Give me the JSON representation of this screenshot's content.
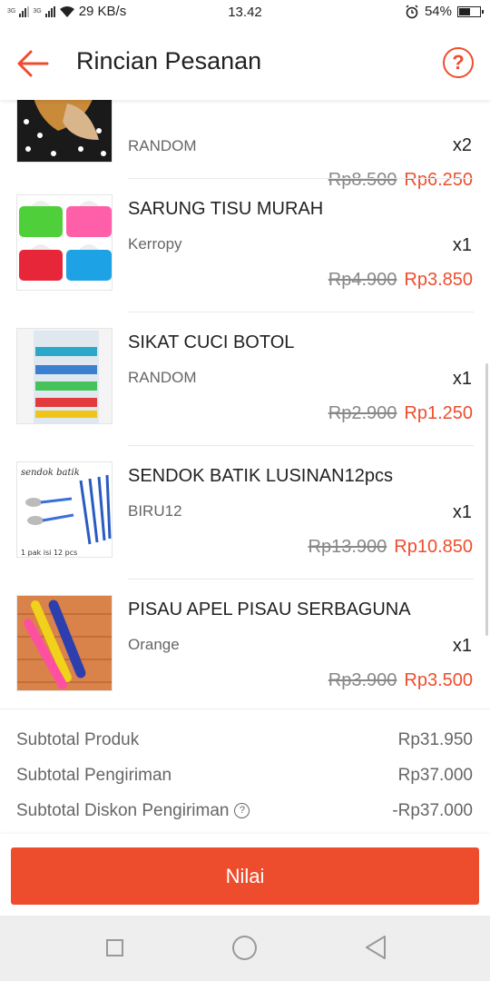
{
  "status_bar": {
    "network_left": "3G",
    "network_right": "3G",
    "speed": "29 KB/s",
    "time": "13.42",
    "battery": "54%",
    "icons": [
      "signal-icon",
      "wifi-icon",
      "alarm-icon",
      "battery-icon"
    ]
  },
  "header": {
    "title": "Rincian Pesanan",
    "help_label": "?",
    "icons": [
      "back-arrow-icon",
      "help-icon"
    ]
  },
  "items": [
    {
      "name": "",
      "variant": "RANDOM",
      "qty": "x2",
      "old_price": "Rp8.500",
      "new_price": "Rp6.250"
    },
    {
      "name": "SARUNG TISU MURAH",
      "variant": "Kerropy",
      "qty": "x1",
      "old_price": "Rp4.900",
      "new_price": "Rp3.850"
    },
    {
      "name": "SIKAT CUCI BOTOL",
      "variant": "RANDOM",
      "qty": "x1",
      "old_price": "Rp2.900",
      "new_price": "Rp1.250"
    },
    {
      "name": "SENDOK BATIK LUSINAN12pcs",
      "variant": "BIRU12",
      "qty": "x1",
      "old_price": "Rp13.900",
      "new_price": "Rp10.850"
    },
    {
      "name": "PISAU APEL PISAU SERBAGUNA",
      "variant": "Orange",
      "qty": "x1",
      "old_price": "Rp3.900",
      "new_price": "Rp3.500"
    }
  ],
  "thumb_text": {
    "spoon_title": "sendok batik",
    "spoon_caption": "1 pak isi 12 pcs"
  },
  "summary": {
    "subtotal_product_label": "Subtotal Produk",
    "subtotal_product_value": "Rp31.950",
    "subtotal_shipping_label": "Subtotal Pengiriman",
    "subtotal_shipping_value": "Rp37.000",
    "shipping_discount_label": "Subtotal Diskon Pengiriman",
    "shipping_discount_value": "-Rp37.000",
    "info_icon_label": "?"
  },
  "action": {
    "rate_label": "Nilai"
  },
  "colors": {
    "accent": "#ee4d2d",
    "text": "#222222",
    "muted": "#666666"
  }
}
